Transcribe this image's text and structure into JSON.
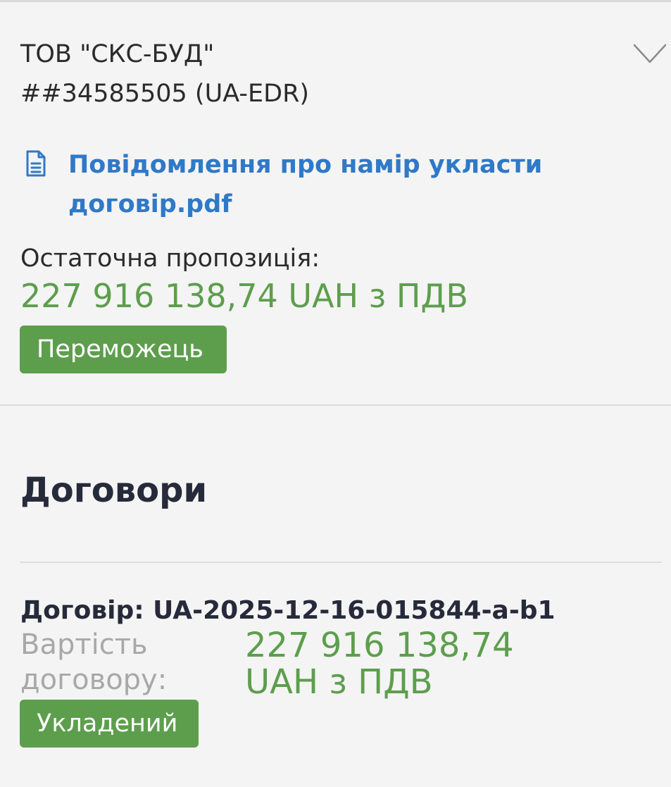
{
  "bidder": {
    "name": "ТОВ \"СКС-БУД\"",
    "id": "##34585505 (UA-EDR)",
    "expand_icon": "chevron-down-icon"
  },
  "document": {
    "icon": "document-icon",
    "link_text": "Повідомлення про намір укласти договір.pdf"
  },
  "offer": {
    "label": "Остаточна пропозиція:",
    "value": "227 916 138,74 UAH з ПДВ",
    "badge": "Переможець"
  },
  "contracts": {
    "title": "Договори",
    "items": [
      {
        "title": "Договір: UA-2025-12-16-015844-a-b1",
        "cost_label": "Вартість договору:",
        "cost_value": "227 916 138,74 UAH з ПДВ",
        "status": "Укладений"
      }
    ]
  },
  "colors": {
    "accent_green": "#5d9e4d",
    "link_blue": "#2f79c7",
    "background": "#f4f4f4"
  }
}
